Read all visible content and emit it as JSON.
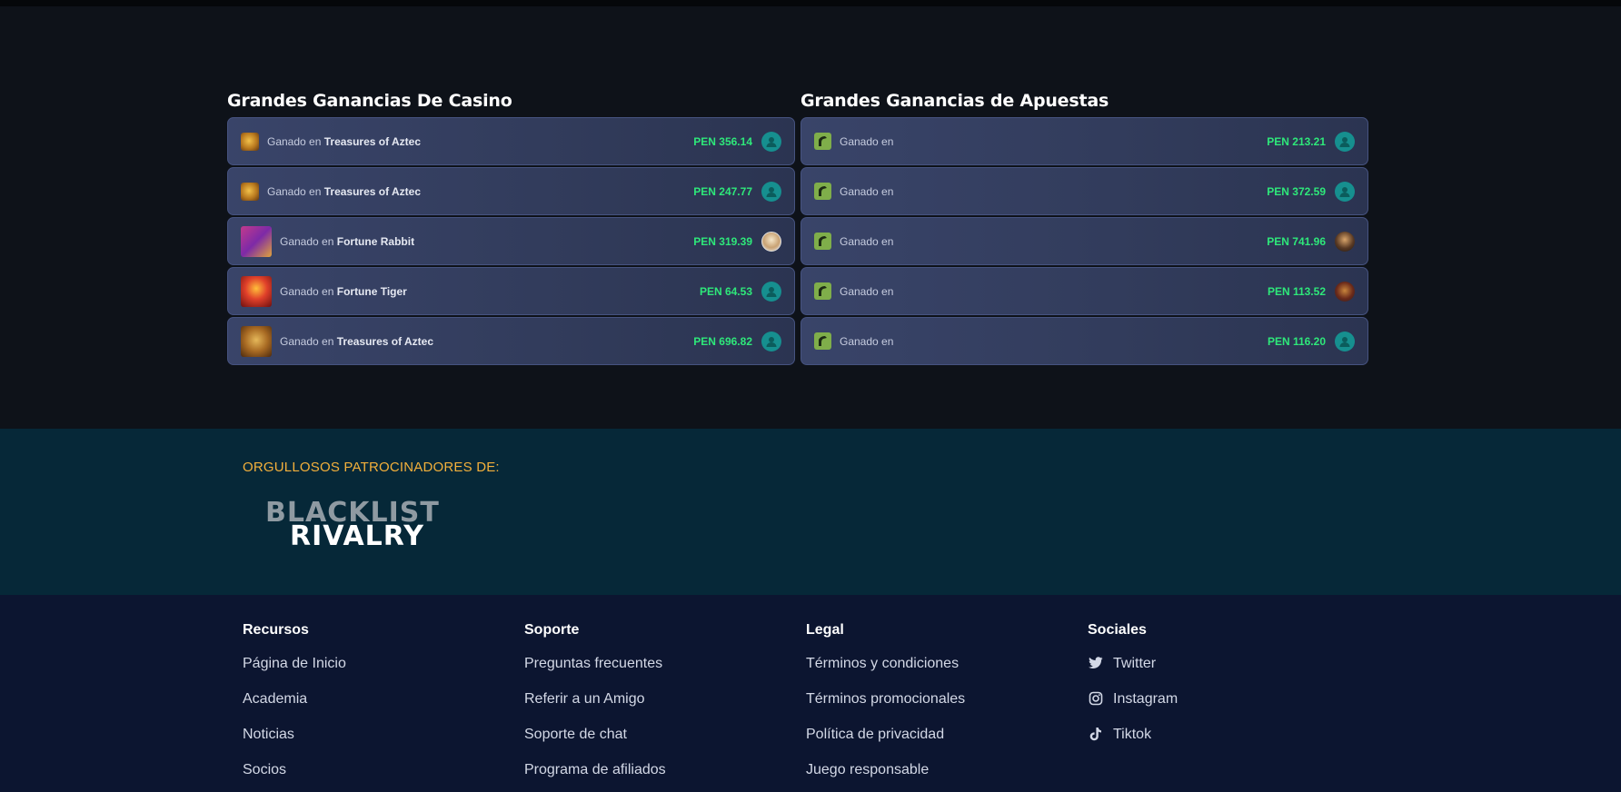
{
  "casino": {
    "title": "Grandes Ganancias De Casino",
    "rows": [
      {
        "thumb": "aztec",
        "prefix": "Ganado en",
        "game": "Treasures of Aztec",
        "amount": "PEN 356.14",
        "avatar": "default"
      },
      {
        "thumb": "aztec",
        "prefix": "Ganado en",
        "game": "Treasures of Aztec",
        "amount": "PEN 247.77",
        "avatar": "default"
      },
      {
        "thumb": "rabbit",
        "prefix": "Ganado en",
        "game": "Fortune Rabbit",
        "amount": "PEN 319.39",
        "avatar": "photo1"
      },
      {
        "thumb": "tiger",
        "prefix": "Ganado en",
        "game": "Fortune Tiger",
        "amount": "PEN 64.53",
        "avatar": "default"
      },
      {
        "thumb": "aztec-big",
        "prefix": "Ganado en",
        "game": "Treasures of Aztec",
        "amount": "PEN 696.82",
        "avatar": "default"
      }
    ]
  },
  "bets": {
    "title": "Grandes Ganancias de Apuestas",
    "rows": [
      {
        "prefix": "Ganado en",
        "amount": "PEN 213.21",
        "avatar": "default"
      },
      {
        "prefix": "Ganado en",
        "amount": "PEN 372.59",
        "avatar": "default"
      },
      {
        "prefix": "Ganado en",
        "amount": "PEN 741.96",
        "avatar": "photo2"
      },
      {
        "prefix": "Ganado en",
        "amount": "PEN 113.52",
        "avatar": "photo3"
      },
      {
        "prefix": "Ganado en",
        "amount": "PEN 116.20",
        "avatar": "default"
      }
    ]
  },
  "sponsors": {
    "title": "ORGULLOSOS PATROCINADORES DE:",
    "logo_line1": "BLACKLIST",
    "logo_line2": "RIVALRY"
  },
  "footer": {
    "recursos": {
      "title": "Recursos",
      "links": [
        "Página de Inicio",
        "Academia",
        "Noticias",
        "Socios"
      ]
    },
    "soporte": {
      "title": "Soporte",
      "links": [
        "Preguntas frecuentes",
        "Referir a un Amigo",
        "Soporte de chat",
        "Programa de afiliados"
      ]
    },
    "legal": {
      "title": "Legal",
      "links": [
        "Términos y condiciones",
        "Términos promocionales",
        "Política de privacidad",
        "Juego responsable"
      ]
    },
    "sociales": {
      "title": "Sociales",
      "links": [
        {
          "label": "Twitter",
          "icon": "twitter-icon"
        },
        {
          "label": "Instagram",
          "icon": "instagram-icon"
        },
        {
          "label": "Tiktok",
          "icon": "tiktok-icon"
        }
      ]
    }
  },
  "colors": {
    "amount": "#2ee87a",
    "sponsor_title": "#f3b03b",
    "row_bg": "#394469"
  }
}
